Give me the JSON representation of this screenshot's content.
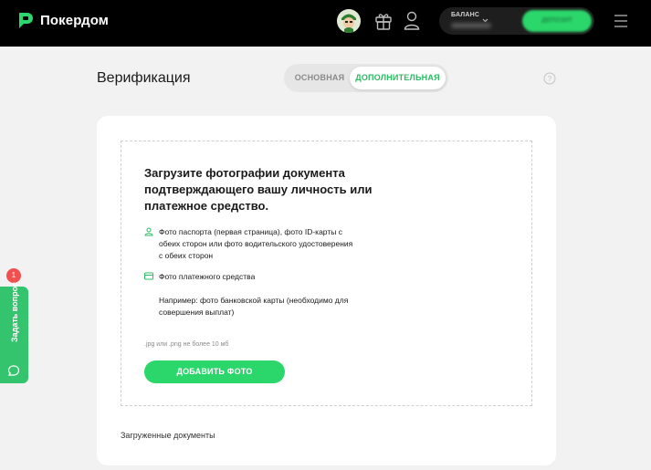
{
  "header": {
    "logo_text": "Покердом",
    "balance_label": "БАЛАНС",
    "deposit_label": "ДЕПОЗИТ",
    "icons": [
      "gift-icon",
      "user-icon",
      "chevron-down-icon",
      "menu-icon"
    ]
  },
  "page": {
    "title": "Верификация",
    "tabs": [
      {
        "label": "ОСНОВНАЯ",
        "active": false
      },
      {
        "label": "ДОПОЛНИТЕЛЬНАЯ",
        "active": true
      }
    ],
    "help_icon": "question-circle-icon"
  },
  "upload": {
    "title": "Загрузите фотографии документа подтверждающего вашу личность или платежное средство.",
    "requirements": [
      {
        "icon": "person-icon",
        "text": "Фото паспорта (первая страница), фото ID-карты с обеих сторон или фото водительского удостоверения с обеих сторон"
      },
      {
        "icon": "card-icon",
        "text": "Фото платежного средства"
      }
    ],
    "example": "Например: фото банковской карты (необходимо для совершения выплат)",
    "hint": ".jpg или .png не более 10 мб",
    "button_label": "ДОБАВИТЬ ФОТО"
  },
  "uploaded_label": "Загруженные документы",
  "ask_question": {
    "label": "Задать вопрос",
    "badge": "1",
    "icon": "chat-bubble-icon"
  },
  "colors": {
    "accent": "#2bd66b",
    "accent_text": "#2bbd63",
    "header_bg": "#000000",
    "page_bg": "#f2f2f2",
    "badge": "#f05050"
  }
}
